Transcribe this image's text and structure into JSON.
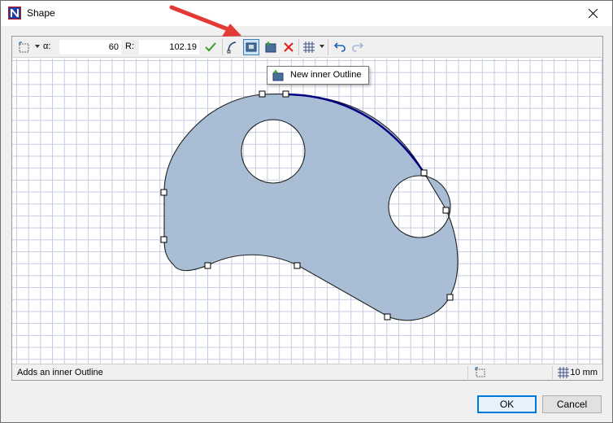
{
  "window": {
    "title": "Shape"
  },
  "toolbar": {
    "alpha_label": "α:",
    "alpha_value": "60",
    "radius_label": "R:",
    "radius_value": "102.19"
  },
  "tooltip": {
    "text": "New inner Outline"
  },
  "status": {
    "text": "Adds an inner Outline",
    "grid_size": "10 mm"
  },
  "buttons": {
    "ok": "OK",
    "cancel": "Cancel"
  },
  "colors": {
    "shape_fill": "#a4bad2",
    "highlight_edge": "#000080",
    "accent": "#0078d7",
    "arrow": "#e53935"
  }
}
